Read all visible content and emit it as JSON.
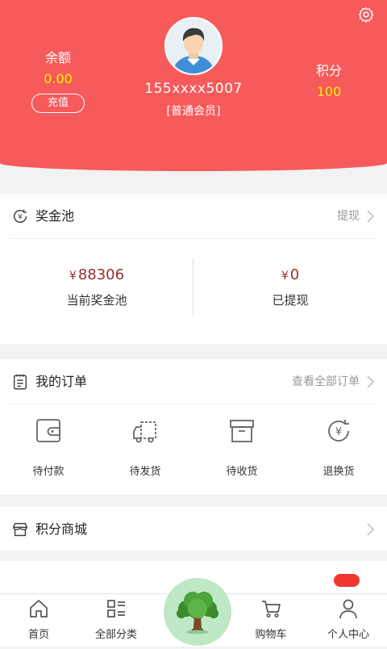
{
  "header": {
    "balance_label": "余额",
    "balance_value": "0.00",
    "recharge_label": "充值",
    "phone": "155xxxx5007",
    "member_level": "[普通会员]",
    "points_label": "积分",
    "points_value": "100",
    "background_color": "#f75a5b",
    "value_color": "#fff200"
  },
  "prize_pool": {
    "title": "奖金池",
    "withdraw_link": "提现",
    "current_amount": "88306",
    "current_label": "当前奖金池",
    "withdrawn_amount": "0",
    "withdrawn_label": "已提现",
    "currency_symbol": "¥",
    "icon": "yen-refresh-icon"
  },
  "orders": {
    "title": "我的订单",
    "view_all": "查看全部订单",
    "icon": "clipboard-icon",
    "items": [
      {
        "label": "待付款",
        "icon": "wallet-icon"
      },
      {
        "label": "待发货",
        "icon": "truck-icon"
      },
      {
        "label": "待收货",
        "icon": "box-icon"
      },
      {
        "label": "退换货",
        "icon": "yen-refund-icon"
      }
    ]
  },
  "points_mall": {
    "title": "积分商城",
    "icon": "store-icon"
  },
  "tabbar": {
    "items": [
      {
        "label": "首页",
        "icon": "home-icon"
      },
      {
        "label": "全部分类",
        "icon": "category-icon"
      },
      {
        "label": "",
        "icon": "tree-icon"
      },
      {
        "label": "购物车",
        "icon": "cart-icon"
      },
      {
        "label": "个人中心",
        "icon": "person-icon"
      }
    ]
  }
}
